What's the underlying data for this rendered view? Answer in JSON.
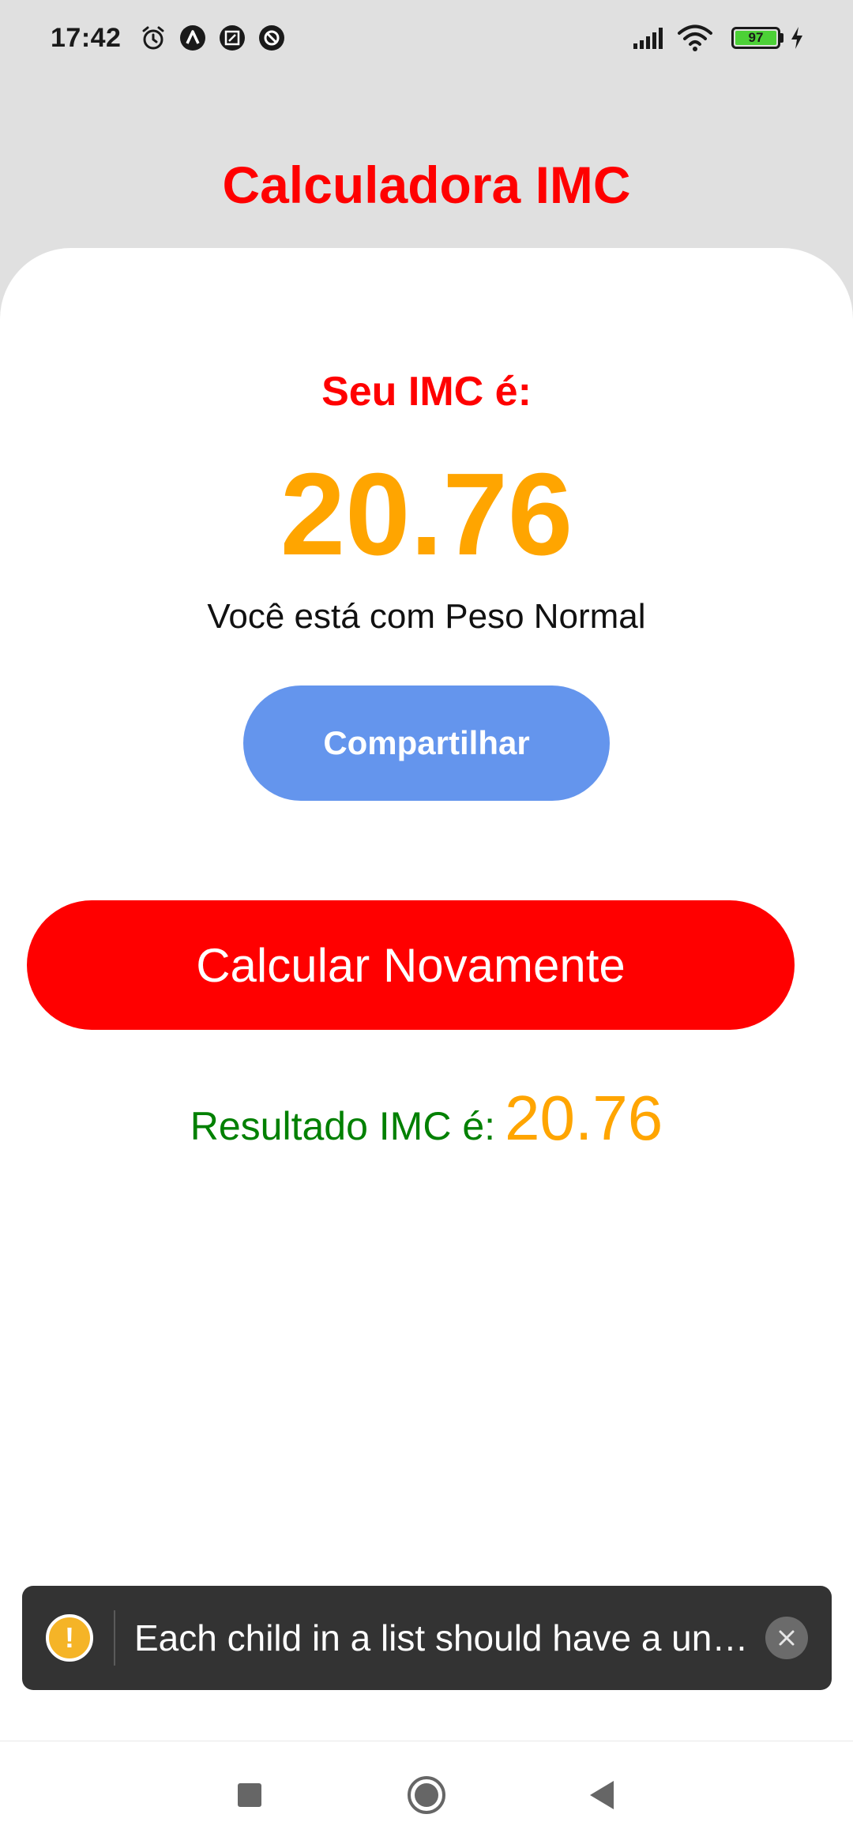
{
  "status_bar": {
    "time": "17:42",
    "left_icons": [
      "alarm-icon",
      "navigation-app-icon",
      "screenshot-app-icon",
      "data-saver-icon"
    ],
    "right_icons": [
      "signal-icon",
      "wifi-icon",
      "battery-icon",
      "charging-icon"
    ],
    "battery_level": "97"
  },
  "app": {
    "title": "Calculadora IMC"
  },
  "result": {
    "label": "Seu IMC é:",
    "value": "20.76",
    "status": "Você está com Peso Normal"
  },
  "buttons": {
    "share_label": "Compartilhar",
    "recalc_label": "Calcular Novamente"
  },
  "summary": {
    "label": "Resultado IMC é:",
    "value": "20.76"
  },
  "toast": {
    "icon": "warning-icon",
    "icon_glyph": "!",
    "message": "Each child in a list should have a unique \"key\" prop.",
    "close_icon": "close-icon"
  },
  "nav": {
    "icons": [
      "recents-square-icon",
      "home-circle-icon",
      "back-triangle-icon"
    ]
  },
  "colors": {
    "title": "#ff0000",
    "value": "#ffa500",
    "share_button": "#6495ed",
    "recalc_button": "#ff0000",
    "summary_label": "#008000",
    "header_bg": "#e0e0e0",
    "toast_bg": "#333333"
  }
}
